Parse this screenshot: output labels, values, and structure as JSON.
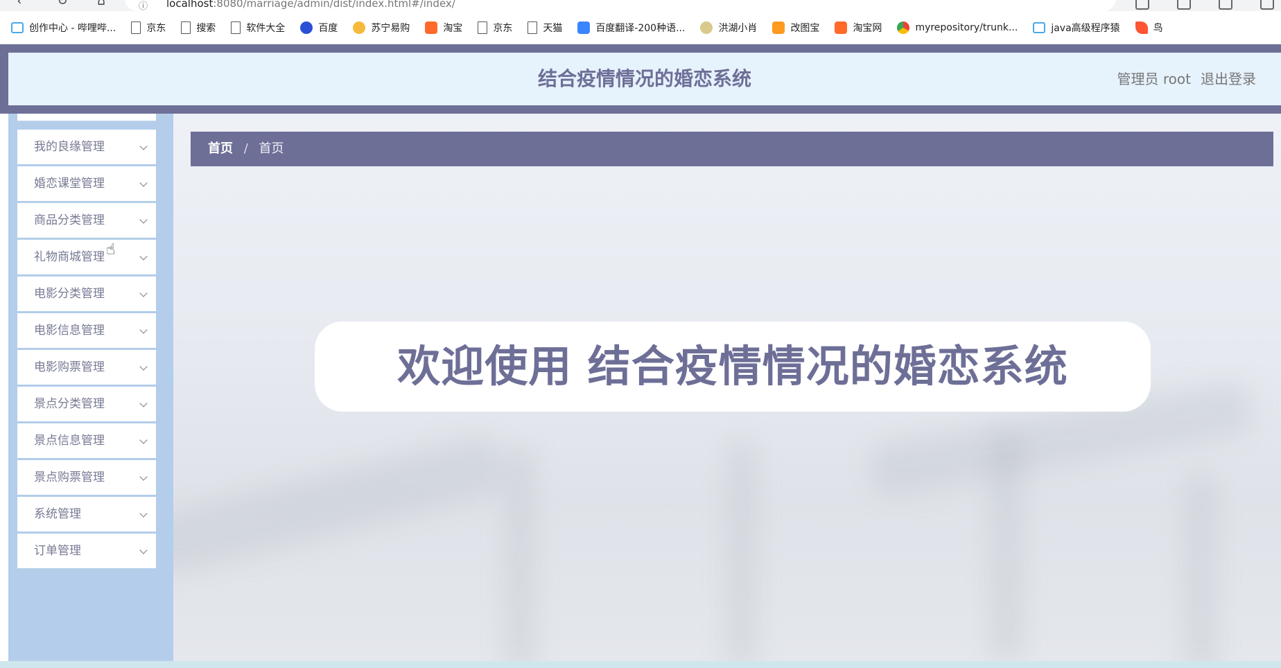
{
  "browser": {
    "address": {
      "info_icon": "info-icon",
      "host": "localhost",
      "rest": ":8080/marriage/admin/dist/index.html#/index/"
    },
    "bookmarks": [
      {
        "label": "创作中心 - 哔哩哔...",
        "icon": "bilibili-icon"
      },
      {
        "label": "京东",
        "icon": "page-icon"
      },
      {
        "label": "搜索",
        "icon": "page-icon"
      },
      {
        "label": "软件大全",
        "icon": "page-icon"
      },
      {
        "label": "百度",
        "icon": "baidu-icon"
      },
      {
        "label": "苏宁易购",
        "icon": "suning-icon"
      },
      {
        "label": "淘宝",
        "icon": "taobao-icon"
      },
      {
        "label": "京东",
        "icon": "page-icon"
      },
      {
        "label": "天猫",
        "icon": "page-icon"
      },
      {
        "label": "百度翻译-200种语...",
        "icon": "fanyi-icon"
      },
      {
        "label": "洪湖小肖",
        "icon": "bee-icon"
      },
      {
        "label": "改图宝",
        "icon": "gaitubao-icon"
      },
      {
        "label": "淘宝网",
        "icon": "taobao-icon"
      },
      {
        "label": "myrepository/trunk...",
        "icon": "chrome-icon"
      },
      {
        "label": "java高级程序猿",
        "icon": "bilibili-icon"
      },
      {
        "label": "鸟",
        "icon": "bird-icon"
      }
    ]
  },
  "header": {
    "title": "结合疫情情况的婚恋系统",
    "admin_label": "管理员 root",
    "logout_label": "退出登录"
  },
  "sidebar": {
    "items": [
      {
        "label": "我的良缘管理"
      },
      {
        "label": "婚恋课堂管理"
      },
      {
        "label": "商品分类管理"
      },
      {
        "label": "礼物商城管理"
      },
      {
        "label": "电影分类管理"
      },
      {
        "label": "电影信息管理"
      },
      {
        "label": "电影购票管理"
      },
      {
        "label": "景点分类管理"
      },
      {
        "label": "景点信息管理"
      },
      {
        "label": "景点购票管理"
      },
      {
        "label": "系统管理"
      },
      {
        "label": "订单管理"
      }
    ]
  },
  "breadcrumb": {
    "home": "首页",
    "separator": "/",
    "current": "首页"
  },
  "main": {
    "welcome": "欢迎使用 结合疫情情况的婚恋系统"
  },
  "colors": {
    "accent": "#6e6f97",
    "sidebar_bg": "#b3cdea",
    "header_bg": "#e6f2fc"
  }
}
